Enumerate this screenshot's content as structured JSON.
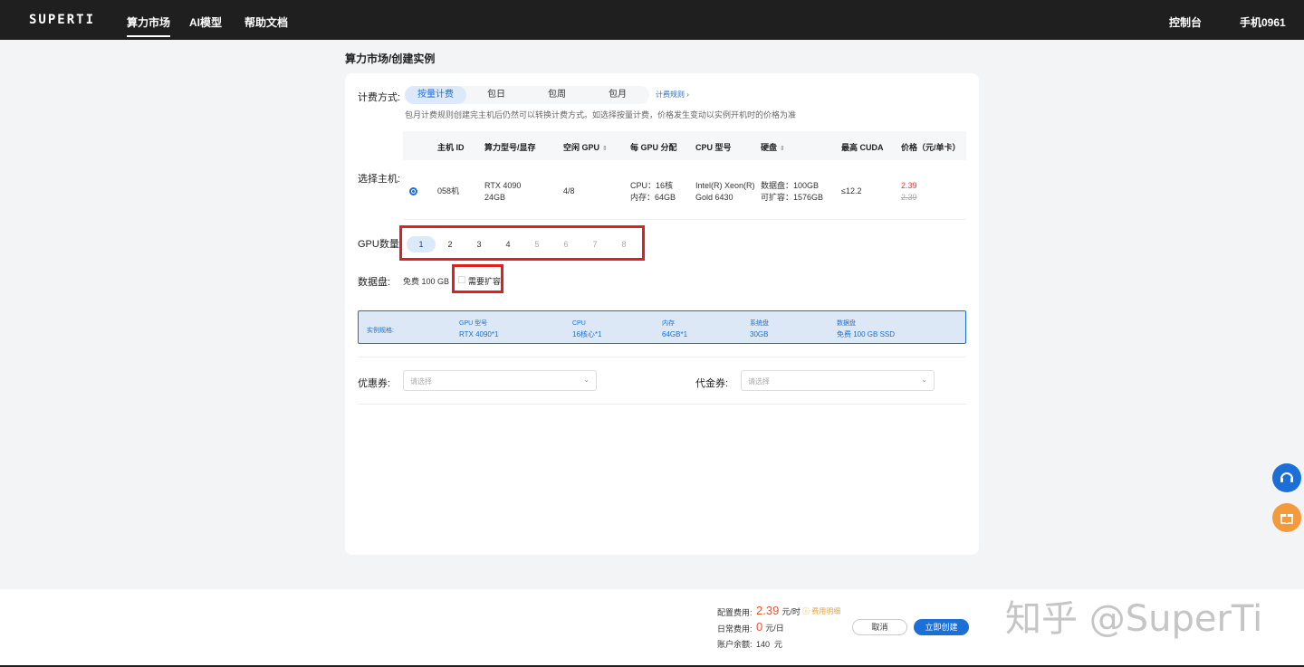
{
  "nav": {
    "logo": "SUPERTI",
    "items": [
      "算力市场",
      "AI模型",
      "帮助文档"
    ],
    "console": "控制台",
    "user": "手机0961"
  },
  "breadcrumb": "算力市场/创建实例",
  "billing": {
    "label": "计费方式:",
    "tabs": [
      "按量计费",
      "包日",
      "包周",
      "包月"
    ],
    "rule_link": "计费规则 ›",
    "hint": "包月计费规则创建完主机后仍然可以转换计费方式。如选择按量计费，价格发生变动以实例开机时的价格为准"
  },
  "host": {
    "label": "选择主机:",
    "headers": [
      "主机 ID",
      "算力型号/显存",
      "空闲 GPU",
      "每 GPU 分配",
      "CPU 型号",
      "硬盘",
      "最高 CUDA",
      "价格（元/单卡）"
    ],
    "row": {
      "id": "058机",
      "model_line1": "RTX 4090",
      "model_line2": "24GB",
      "free_gpu": "4/8",
      "alloc_cpu": "CPU：16核",
      "alloc_mem": "内存：64GB",
      "cpu_line1": "Intel(R) Xeon(R)",
      "cpu_line2": "Gold 6430",
      "disk_line1": "数据盘：100GB",
      "disk_line2": "可扩容：1576GB",
      "cuda": "≤12.2",
      "price": "2.39",
      "price_old": "2.39"
    }
  },
  "gpu_count": {
    "label": "GPU数量:",
    "options": [
      "1",
      "2",
      "3",
      "4",
      "5",
      "6",
      "7",
      "8"
    ],
    "selected": "1"
  },
  "data_disk": {
    "label": "数据盘:",
    "free": "免费 100 GB",
    "expand": "需要扩容"
  },
  "spec": {
    "label": "实例规格:",
    "gpu_k": "GPU 型号",
    "gpu_v": "RTX 4090*1",
    "cpu_k": "CPU",
    "cpu_v": "16核心*1",
    "mem_k": "内存",
    "mem_v": "64GB*1",
    "sys_k": "系统盘",
    "sys_v": "30GB",
    "data_k": "数据盘",
    "data_v": "免费 100 GB SSD"
  },
  "coupon": {
    "label": "优惠券:",
    "placeholder": "请选择"
  },
  "voucher": {
    "label": "代金券:",
    "placeholder": "请选择"
  },
  "footer": {
    "config_k": "配置费用:",
    "config_v": "2.39",
    "config_unit": "元/时",
    "detail": "ⓘ 费用明细",
    "daily_k": "日常费用:",
    "daily_v": "0",
    "daily_unit": "元/日",
    "balance_k": "账户余额:",
    "balance_v": "140",
    "balance_unit": "元",
    "cancel": "取消",
    "create": "立即创建"
  },
  "watermark": "知乎 @SuperTi"
}
